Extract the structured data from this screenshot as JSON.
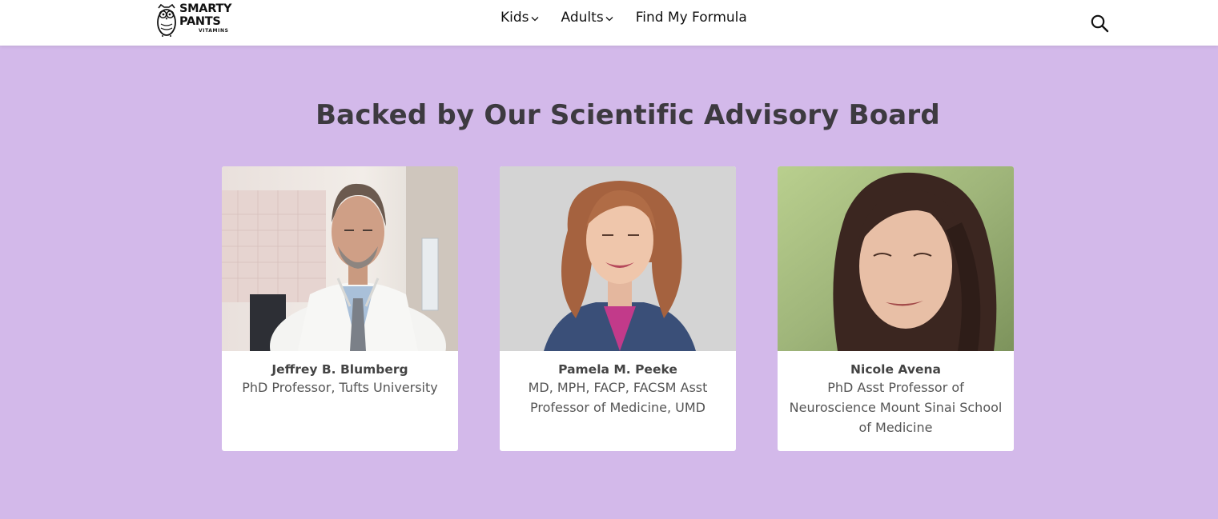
{
  "brand": {
    "line1": "SMARTY",
    "line2": "PANTS",
    "line3": "VITAMINS"
  },
  "nav": {
    "items": [
      {
        "label": "Kids",
        "has_dropdown": true
      },
      {
        "label": "Adults",
        "has_dropdown": true
      },
      {
        "label": "Find My Formula",
        "has_dropdown": false
      }
    ],
    "search_icon": "search-icon"
  },
  "section": {
    "title": "Backed by Our Scientific Advisory Board",
    "background": "#d3b9ea"
  },
  "advisors": [
    {
      "name": "Jeffrey B. Blumberg",
      "role": "PhD Professor, Tufts University"
    },
    {
      "name": "Pamela M. Peeke",
      "role": "MD, MPH, FACP, FACSM Asst Professor of Medicine, UMD"
    },
    {
      "name": "Nicole Avena",
      "role": "PhD Asst Professor of Neuroscience Mount Sinai School of Medicine"
    }
  ]
}
